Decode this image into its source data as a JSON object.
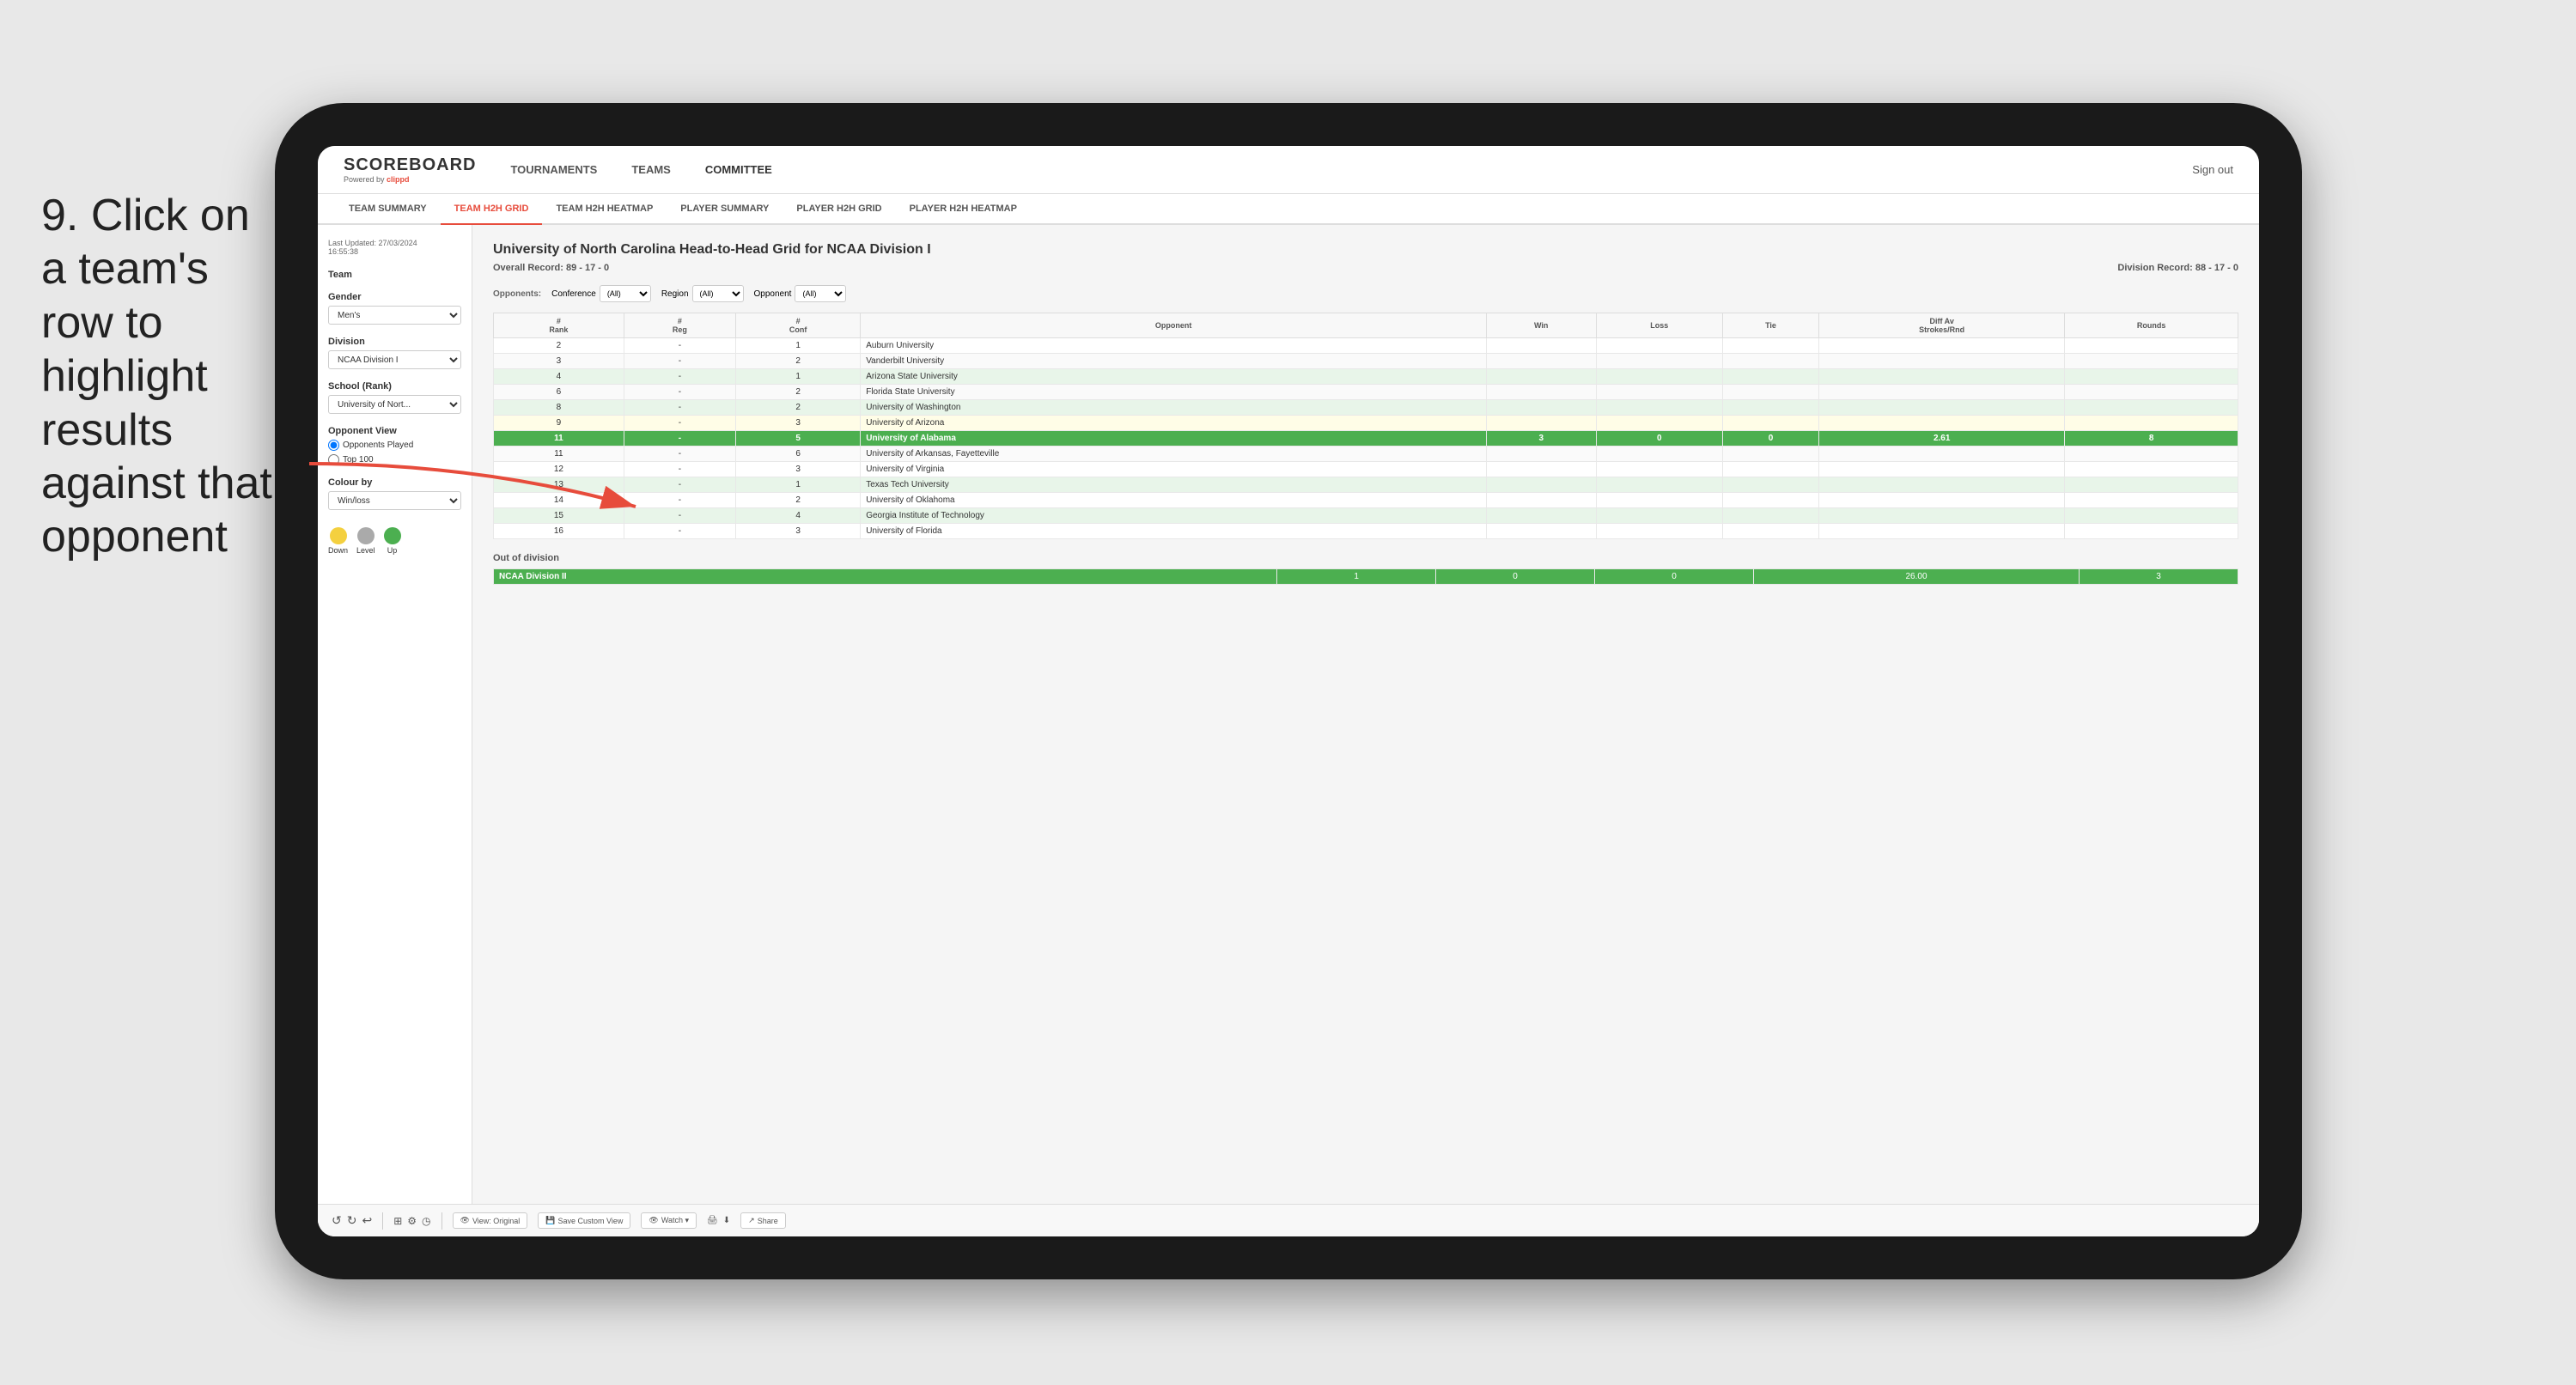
{
  "instruction": {
    "step": "9.",
    "text": "Click on a team's row to highlight results against that opponent"
  },
  "nav": {
    "logo": "SCOREBOARD",
    "powered_by": "Powered by",
    "brand": "clippd",
    "items": [
      {
        "label": "TOURNAMENTS",
        "active": false
      },
      {
        "label": "TEAMS",
        "active": false
      },
      {
        "label": "COMMITTEE",
        "active": true
      }
    ],
    "sign_out": "Sign out"
  },
  "sub_tabs": [
    {
      "label": "TEAM SUMMARY",
      "active": false
    },
    {
      "label": "TEAM H2H GRID",
      "active": true
    },
    {
      "label": "TEAM H2H HEATMAP",
      "active": false
    },
    {
      "label": "PLAYER SUMMARY",
      "active": false
    },
    {
      "label": "PLAYER H2H GRID",
      "active": false
    },
    {
      "label": "PLAYER H2H HEATMAP",
      "active": false
    }
  ],
  "sidebar": {
    "last_updated_label": "Last Updated: 27/03/2024",
    "time": "16:55:38",
    "team_label": "Team",
    "gender_label": "Gender",
    "gender_value": "Men's",
    "division_label": "Division",
    "division_value": "NCAA Division I",
    "school_label": "School (Rank)",
    "school_value": "University of Nort...",
    "opponent_view_label": "Opponent View",
    "radio1": "Opponents Played",
    "radio2": "Top 100",
    "colour_by_label": "Colour by",
    "colour_by_value": "Win/loss",
    "legend": [
      {
        "label": "Down",
        "color": "#f4d03f"
      },
      {
        "label": "Level",
        "color": "#aaaaaa"
      },
      {
        "label": "Up",
        "color": "#4caf50"
      }
    ]
  },
  "panel": {
    "title": "University of North Carolina Head-to-Head Grid for NCAA Division I",
    "overall_record_label": "Overall Record:",
    "overall_record": "89 - 17 - 0",
    "division_record_label": "Division Record:",
    "division_record": "88 - 17 - 0",
    "filters": {
      "opponents_label": "Opponents:",
      "conference_label": "Conference",
      "conference_value": "(All)",
      "region_label": "Region",
      "region_value": "(All)",
      "opponent_label": "Opponent",
      "opponent_value": "(All)"
    },
    "table_headers": [
      "#\nRank",
      "#\nReg",
      "#\nConf",
      "Opponent",
      "Win",
      "Loss",
      "Tie",
      "Diff Av\nStrokes/Rnd",
      "Rounds"
    ],
    "rows": [
      {
        "rank": "2",
        "reg": "-",
        "conf": "1",
        "opponent": "Auburn University",
        "win": "",
        "loss": "",
        "tie": "",
        "diff": "",
        "rounds": "",
        "style": "normal"
      },
      {
        "rank": "3",
        "reg": "-",
        "conf": "2",
        "opponent": "Vanderbilt University",
        "win": "",
        "loss": "",
        "tie": "",
        "diff": "",
        "rounds": "",
        "style": "normal"
      },
      {
        "rank": "4",
        "reg": "-",
        "conf": "1",
        "opponent": "Arizona State University",
        "win": "",
        "loss": "",
        "tie": "",
        "diff": "",
        "rounds": "",
        "style": "light-green"
      },
      {
        "rank": "6",
        "reg": "-",
        "conf": "2",
        "opponent": "Florida State University",
        "win": "",
        "loss": "",
        "tie": "",
        "diff": "",
        "rounds": "",
        "style": "normal"
      },
      {
        "rank": "8",
        "reg": "-",
        "conf": "2",
        "opponent": "University of Washington",
        "win": "",
        "loss": "",
        "tie": "",
        "diff": "",
        "rounds": "",
        "style": "light-green"
      },
      {
        "rank": "9",
        "reg": "-",
        "conf": "3",
        "opponent": "University of Arizona",
        "win": "",
        "loss": "",
        "tie": "",
        "diff": "",
        "rounds": "",
        "style": "yellow"
      },
      {
        "rank": "11",
        "reg": "-",
        "conf": "5",
        "opponent": "University of Alabama",
        "win": "3",
        "loss": "0",
        "tie": "0",
        "diff": "2.61",
        "rounds": "8",
        "style": "highlighted"
      },
      {
        "rank": "11",
        "reg": "-",
        "conf": "6",
        "opponent": "University of Arkansas, Fayetteville",
        "win": "",
        "loss": "",
        "tie": "",
        "diff": "",
        "rounds": "",
        "style": "normal"
      },
      {
        "rank": "12",
        "reg": "-",
        "conf": "3",
        "opponent": "University of Virginia",
        "win": "",
        "loss": "",
        "tie": "",
        "diff": "",
        "rounds": "",
        "style": "normal"
      },
      {
        "rank": "13",
        "reg": "-",
        "conf": "1",
        "opponent": "Texas Tech University",
        "win": "",
        "loss": "",
        "tie": "",
        "diff": "",
        "rounds": "",
        "style": "light-green"
      },
      {
        "rank": "14",
        "reg": "-",
        "conf": "2",
        "opponent": "University of Oklahoma",
        "win": "",
        "loss": "",
        "tie": "",
        "diff": "",
        "rounds": "",
        "style": "normal"
      },
      {
        "rank": "15",
        "reg": "-",
        "conf": "4",
        "opponent": "Georgia Institute of Technology",
        "win": "",
        "loss": "",
        "tie": "",
        "diff": "",
        "rounds": "",
        "style": "light-green"
      },
      {
        "rank": "16",
        "reg": "-",
        "conf": "3",
        "opponent": "University of Florida",
        "win": "",
        "loss": "",
        "tie": "",
        "diff": "",
        "rounds": "",
        "style": "normal"
      }
    ],
    "out_of_division_label": "Out of division",
    "out_div_rows": [
      {
        "label": "NCAA Division II",
        "win": "1",
        "loss": "0",
        "tie": "0",
        "diff": "26.00",
        "rounds": "3"
      }
    ]
  },
  "toolbar": {
    "undo_label": "↺",
    "redo_label": "↻",
    "view_original_label": "View: Original",
    "save_custom_label": "Save Custom View",
    "watch_label": "Watch ▾",
    "share_label": "Share"
  }
}
